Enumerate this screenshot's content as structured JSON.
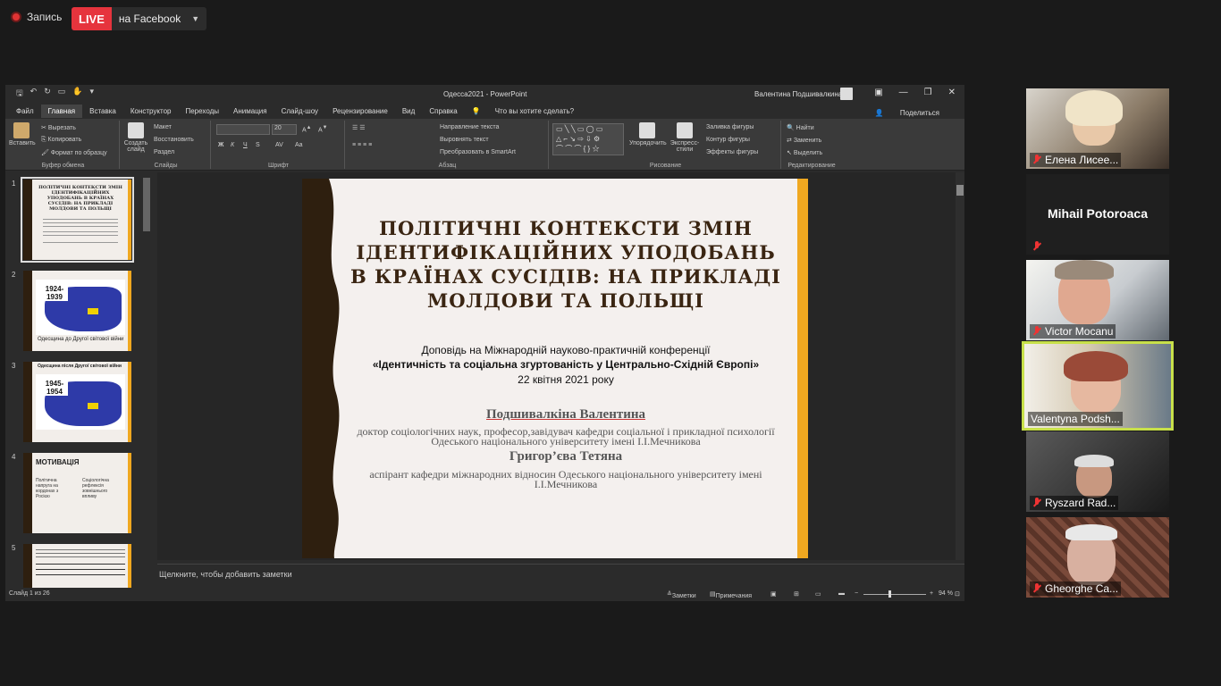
{
  "zoom": {
    "recording_label": "Запись",
    "live_badge": "LIVE",
    "live_target": "на Facebook"
  },
  "ppt": {
    "doc_title": "Одесса2021  -  PowerPoint",
    "user_name": "Валентина Подшивалкина",
    "tabs": [
      "Файл",
      "Главная",
      "Вставка",
      "Конструктор",
      "Переходы",
      "Анимация",
      "Слайд-шоу",
      "Рецензирование",
      "Вид",
      "Справка"
    ],
    "active_tab": "Главная",
    "tell_me": "Что вы хотите сделать?",
    "share": "Поделиться",
    "ribbon": {
      "clipboard": {
        "paste": "Вставить",
        "cut": "Вырезать",
        "copy": "Копировать",
        "format_painter": "Формат по образцу",
        "label": "Буфер обмена"
      },
      "slides": {
        "new_slide": "Создать слайд",
        "layout": "Макет",
        "reset": "Восстановить",
        "section": "Раздел",
        "label": "Слайды"
      },
      "font": {
        "size": "20",
        "label": "Шрифт",
        "bold": "Ж",
        "italic": "К",
        "underline": "Ч",
        "strike": "S",
        "spacing": "AV",
        "case": "Aa"
      },
      "paragraph": {
        "direction": "Направление текста",
        "align": "Выровнять текст",
        "smartart": "Преобразовать в SmartArt",
        "label": "Абзац"
      },
      "drawing": {
        "arrange": "Упорядочить",
        "quick_styles": "Экспресс-стили",
        "fill": "Заливка фигуры",
        "outline": "Контур фигуры",
        "effects": "Эффекты фигуры",
        "label": "Рисование"
      },
      "editing": {
        "find": "Найти",
        "replace": "Заменить",
        "select": "Выделить",
        "label": "Редактирование"
      }
    },
    "thumbnails": [
      {
        "num": "1",
        "title": "ПОЛІТИЧНІ КОНТЕКСТИ ЗМІН ІДЕНТИФІКАЦІЙНИХ УПОДОБАНЬ В КРАЇНАХ СУСІДІВ: НА ПРИКЛАДІ МОЛДОВИ ТА ПОЛЬЩІ"
      },
      {
        "num": "2",
        "year": "1924-1939",
        "caption": "Одесщина до Другої світової війни"
      },
      {
        "num": "3",
        "year": "1945-1954",
        "caption": "Одесщина після Другої світової війни"
      },
      {
        "num": "4",
        "title": "МОТИВАЦІЯ",
        "col1": "Політична напруга на кордонах з Росією",
        "col2": "Соціологічна рефлексія зовнішнього впливу"
      },
      {
        "num": "5"
      }
    ],
    "slide": {
      "title": "ПОЛІТИЧНІ КОНТЕКСТИ ЗМІН ІДЕНТИФІКАЦІЙНИХ УПОДОБАНЬ В КРАЇНАХ СУСІДІВ: НА ПРИКЛАДІ МОЛДОВИ ТА ПОЛЬЩІ",
      "report_line1": "Доповідь на Міжнародній науково-практичній конференції",
      "report_line2": "«Ідентичність та соціальна згуртованість у Центрально-Східній Європі»",
      "report_date": "22 квітня 2021 року",
      "author1": "Подшивалкіна  Валентина",
      "author1_desc": "доктор соціологічних наук, професор,завідувач кафедри  соціальної і прикладної психології Одеського національного університету імені І.І.Мечникова",
      "author2": "Григор’єва Тетяна",
      "author2_desc": "аспірант кафедри міжнародних відносин Одеського національного університету імені І.І.Мечникова"
    },
    "notes_placeholder": "Щелкните, чтобы добавить заметки",
    "status": {
      "slide_count": "Слайд 1 из 26",
      "notes": "Заметки",
      "comments": "Примечания",
      "zoom": "94 %"
    }
  },
  "participants": [
    {
      "name": "Елена Лисее...",
      "muted": true,
      "video": true
    },
    {
      "name": "Mihail Potoroaca",
      "muted": true,
      "video": false
    },
    {
      "name": "Victor Mocanu",
      "muted": true,
      "video": true
    },
    {
      "name": "Valentyna Podsh...",
      "muted": false,
      "video": true,
      "speaking": true
    },
    {
      "name": "Ryszard Rad...",
      "muted": true,
      "video": true
    },
    {
      "name": "Gheorghe Ca...",
      "muted": true,
      "video": true
    }
  ],
  "colors": {
    "live_red": "#e6343d",
    "slide_accent": "#f0a820",
    "slide_brown": "#2e1f0f",
    "speaker_outline": "#c8e04a"
  }
}
